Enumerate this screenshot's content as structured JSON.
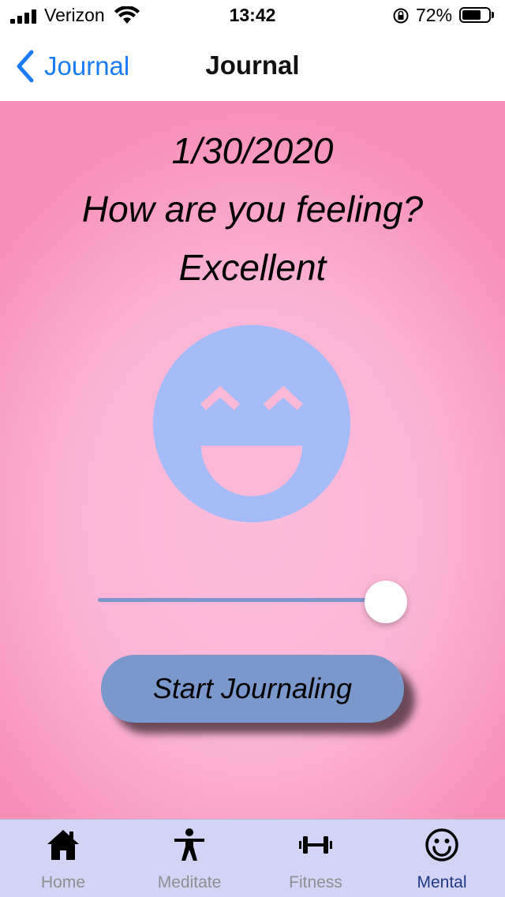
{
  "status_bar": {
    "carrier": "Verizon",
    "time": "13:42",
    "battery": "72%",
    "battery_level": 0.72
  },
  "nav": {
    "back_label": "Journal",
    "title": "Journal"
  },
  "content": {
    "date": "1/30/2020",
    "question": "How are you feeling?",
    "mood": "Excellent",
    "face_icon": "excellent-face-icon",
    "face_color": "#a4bbf8",
    "slider_value": 1.0,
    "button_label": "Start Journaling",
    "button_color": "#7a98cc"
  },
  "tabs": [
    {
      "label": "Home",
      "icon": "home-icon",
      "active": false
    },
    {
      "label": "Meditate",
      "icon": "person-icon",
      "active": false
    },
    {
      "label": "Fitness",
      "icon": "dumbbell-icon",
      "active": false
    },
    {
      "label": "Mental",
      "icon": "smiley-icon",
      "active": true
    }
  ]
}
